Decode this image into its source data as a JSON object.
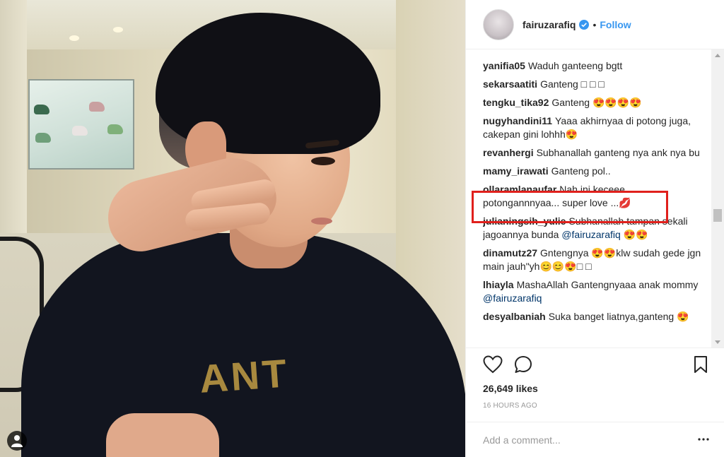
{
  "post": {
    "username": "fairuzarafiq",
    "follow_label": "Follow",
    "separator": "•"
  },
  "comments": [
    {
      "user": "yanifia05",
      "text": "Waduh ganteeng bgtt"
    },
    {
      "user": "sekarsaatiti",
      "text": "Ganteng □ □ □"
    },
    {
      "user": "tengku_tika92",
      "text": "Ganteng 😍😍😍😍"
    },
    {
      "user": "nugyhandini11",
      "text": "Yaaa akhirnyaa di potong juga, cakepan gini lohhh😍"
    },
    {
      "user": "revanhergi",
      "text": "Subhanallah ganteng nya ank nya bu"
    },
    {
      "user": "mamy_irawati",
      "text": "Ganteng pol.."
    },
    {
      "user": "ollaramlanaufar",
      "text": "Nah ini keceee potongannnyaa... super love ...💋"
    },
    {
      "user": "julianingsih_yulie",
      "text": "Subhanallah tampan sekali jagoannya bunda",
      "mention": "@fairuzarafiq",
      "after": " 😍😍"
    },
    {
      "user": "dinamutz27",
      "text": "Gntengnya 😍😍klw sudah gede jgn main jauh\"yh😊😊😍□ □"
    },
    {
      "user": "lhiayla",
      "text": "MashaAllah Gantengnyaaa anak mommy",
      "mention": "@fairuzarafiq",
      "after": ""
    },
    {
      "user": "desyalbaniah",
      "text": "Suka banget liatnya,ganteng 😍"
    }
  ],
  "engagement": {
    "likes": "26,649 likes",
    "time": "16 HOURS AGO"
  },
  "add_comment": {
    "placeholder": "Add a comment..."
  },
  "icons": [
    "user-tag-icon",
    "verified-badge-icon",
    "heart-icon",
    "comment-icon",
    "bookmark-icon",
    "more-options-icon"
  ],
  "colors": {
    "link_blue": "#3897f0",
    "mention_blue": "#003569",
    "highlight_red": "#e0201c",
    "muted_gray": "#999999"
  }
}
